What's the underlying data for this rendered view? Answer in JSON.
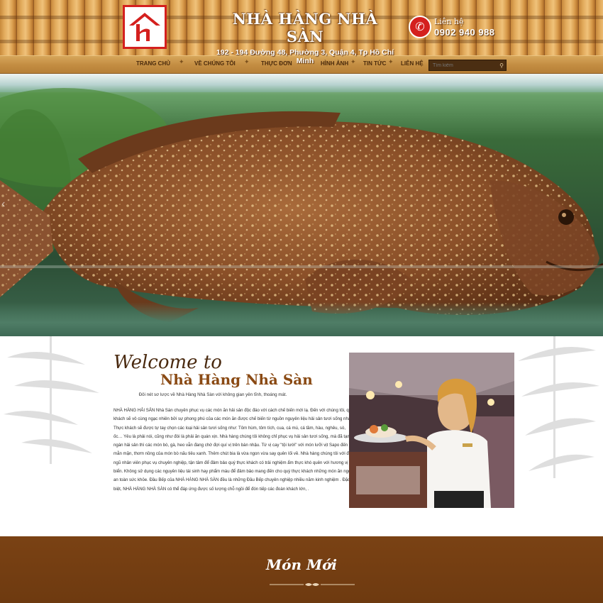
{
  "header": {
    "brand_name": "NHÀ HÀNG NHÀ SÀN",
    "address": "192 - 194 Đường 48, Phường 3, Quận 4, Tp Hồ Chí Minh",
    "contact_label": "Liên hệ",
    "phone": "0902 940 988",
    "logo_glyph": "H"
  },
  "nav": {
    "items": [
      {
        "label": "TRANG CHỦ"
      },
      {
        "label": "VỀ CHÚNG TÔI"
      },
      {
        "label": "THỰC ĐƠN"
      },
      {
        "label": "HÌNH ẢNH"
      },
      {
        "label": "TIN TỨC"
      },
      {
        "label": "LIÊN HỆ"
      }
    ],
    "search_placeholder": "Tìm kiếm"
  },
  "welcome": {
    "script_heading": "Welcome to",
    "title": "Nhà Hàng Nhà Sàn",
    "subtitle": "Đôi nét sơ lược về Nhà Hàng Nhà Sàn với không gian yên tĩnh, thoáng mát.",
    "body": "NHÀ HÀNG HẢI SẢN Nhà Sàn chuyên phục vụ các món ăn hải sản độc đáo với cách chế biến mới lạ. Đến với chúng tôi, quý khách sẽ vô cùng ngạc nhiên bởi sự phong phú của các món ăn được chế biến từ nguồn nguyên liệu hải sản tươi sống nhất. Thực khách sẽ được tự tay chọn các loại hải sản tươi sống như: Tôm hùm, tôm tích, cua, cá mú, cá tầm, hàu, nghêu, sò, ốc… Yêu là phải nói, cũng như đói là phải ăn quán xịn. Nhà hàng chúng tôi không chỉ phục vụ hải sản tươi sống, mà đã tạm ngán hải sản thì các món bò, gà, heo vẫn đang chờ đợi quí vị trên bàn nhậu. Từ vị cay \"tội lưới\" với món lưỡi vịt Sapo đến vị mằn mặn, thơm nồng của món bò nấu tiêu xanh. Thêm chút bia là vừa ngon vừa say quên lối về. Nhà hàng chúng tôi với đội ngũ nhân viên phục vụ chuyên nghiệp, tận tâm để đảm bảo quý thực khách có trải nghiệm ẩm thực khó quên với hương vị biển. Không sử dụng các nguyên liệu tái sinh hay phẩm màu để đảm bảo mang đến cho quý thực khách những món ăn ngon an toàn sức khỏe. Đầu Bếp của NHÀ HÀNG NHÀ SÀN đều là những Đầu Bếp chuyên nghiệp nhiều năm kinh nghiệm . Đặc biệt, NHÀ HÀNG NHÀ SÀN có thể đáp ứng được số lượng chỗ ngồi để đón tiếp các đoàn khách lớn, ."
  },
  "new_dishes": {
    "title": "Món Mới"
  },
  "colors": {
    "brand_red": "#d4201e",
    "wood": "#c8893c",
    "footer_brown": "#7a4214",
    "title_brown": "#8a4a14"
  }
}
